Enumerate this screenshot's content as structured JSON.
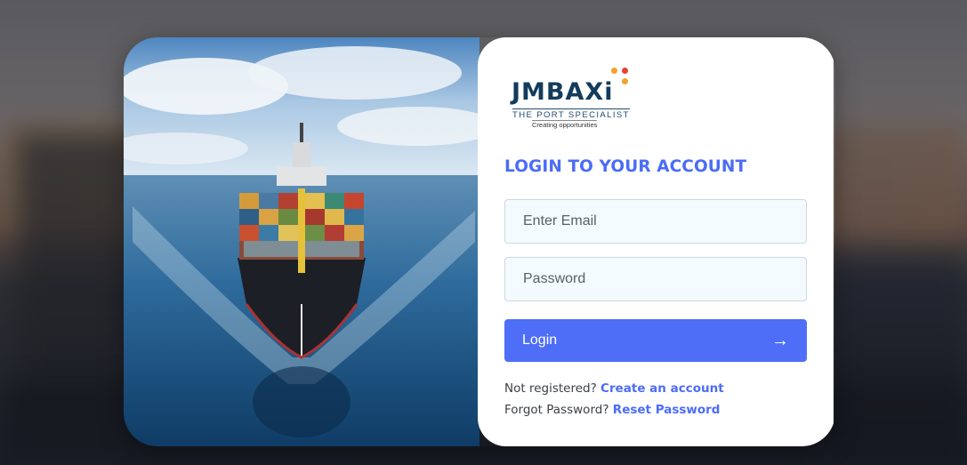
{
  "logo": {
    "name": "JMBAXi",
    "subtitle": "THE PORT SPECIALIST",
    "tagline": "Creating opportunities",
    "dot_colors": [
      "#f2a22b",
      "#e8442d",
      "#f2a22b"
    ]
  },
  "form": {
    "heading": "LOGIN TO YOUR ACCOUNT",
    "email_placeholder": "Enter Email",
    "password_placeholder": "Password",
    "login_label": "Login",
    "login_icon": "arrow-right-icon"
  },
  "links": {
    "register_prompt": "Not registered?",
    "register_link": "Create an account",
    "forgot_prompt": "Forgot Password?",
    "reset_link": "Reset Password"
  },
  "colors": {
    "accent": "#4f6ef7",
    "heading": "#4b6cf7",
    "field_bg": "#f3fbfe"
  }
}
